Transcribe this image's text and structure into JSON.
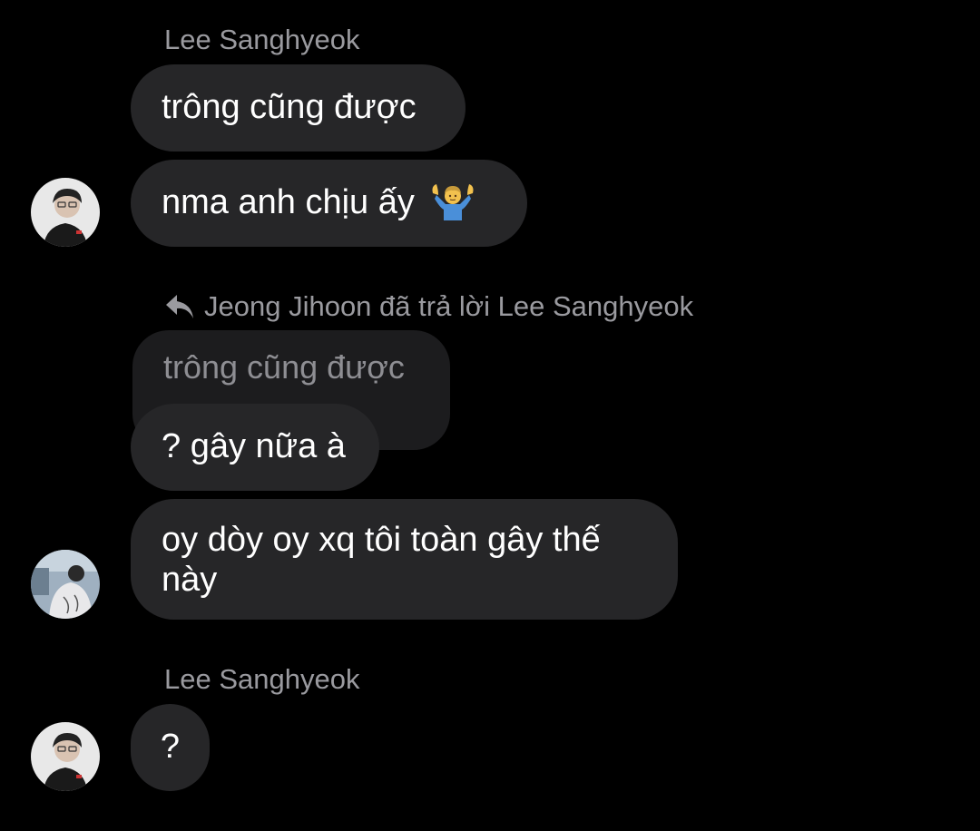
{
  "conversation": {
    "group1": {
      "sender": "Lee Sanghyeok",
      "messages": [
        {
          "text": "trông cũng được"
        },
        {
          "text": "nma anh chịu ấy",
          "emoji": "person-shrugging-emoji"
        }
      ]
    },
    "group2": {
      "reply_header": "Jeong Jihoon đã trả lời Lee Sanghyeok",
      "quoted_text": "trông cũng được",
      "messages": [
        {
          "text": "? gây nữa à"
        },
        {
          "line1": "oy dòy oy xq tôi toàn gây thế",
          "line2": "này"
        }
      ]
    },
    "group3": {
      "sender": "Lee Sanghyeok",
      "messages": [
        {
          "text": "?"
        }
      ]
    }
  },
  "colors": {
    "background": "#000000",
    "bubble": "#262628",
    "quoted_bubble": "#1c1c1e",
    "secondary_text": "#9a9a9f"
  },
  "icons": {
    "reply": "reply-arrow-icon"
  }
}
